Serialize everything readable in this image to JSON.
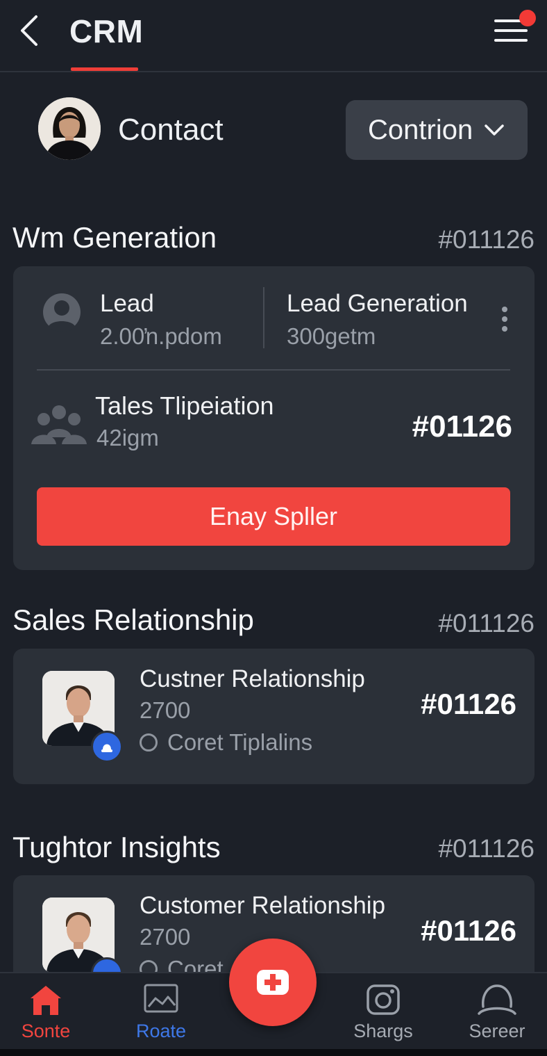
{
  "header": {
    "title": "CRM"
  },
  "contact": {
    "label": "Contact",
    "dropdown_label": "Contrion"
  },
  "sections": [
    {
      "title": "Wm Generation",
      "id": "#011126",
      "card": {
        "lead": {
          "title": "Lead",
          "sub": "2.00ŉ.pdom"
        },
        "lead_generation": {
          "title": "Lead Generation",
          "sub": "300getm"
        },
        "tales": {
          "title": "Tales Tlipeiation",
          "sub": "42igm",
          "id": "#01126"
        },
        "button_label": "Enay Spller"
      }
    },
    {
      "title": "Sales Relationship",
      "id": "#011126",
      "card": {
        "title": "Custner Relationship",
        "count": "2700",
        "meta": "Coret Tiplalins",
        "id": "#01126"
      }
    },
    {
      "title": "Tughtor Insights",
      "id": "#011126",
      "card": {
        "title": "Customer Relationship",
        "count": "2700",
        "meta": "Coret",
        "id": "#01126"
      }
    }
  ],
  "nav": {
    "items": [
      {
        "label": "Sonte",
        "color": "#f1453f"
      },
      {
        "label": "Roate",
        "color": "#3e78e8"
      },
      {
        "label": "Shargs",
        "color": "#a6abb3"
      },
      {
        "label": "Sereer",
        "color": "#a6abb3"
      }
    ]
  },
  "colors": {
    "accent": "#f1453f",
    "background": "#1c2028",
    "card": "#2b3038",
    "badge": "#2e67e0"
  },
  "icons": [
    "back-chevron-icon",
    "hamburger-menu-icon",
    "notification-dot",
    "chevron-down-icon",
    "user-icon",
    "more-vertical-icon",
    "group-icon",
    "home-icon",
    "image-icon",
    "camera-icon",
    "profile-icon",
    "medical-plus-icon"
  ]
}
